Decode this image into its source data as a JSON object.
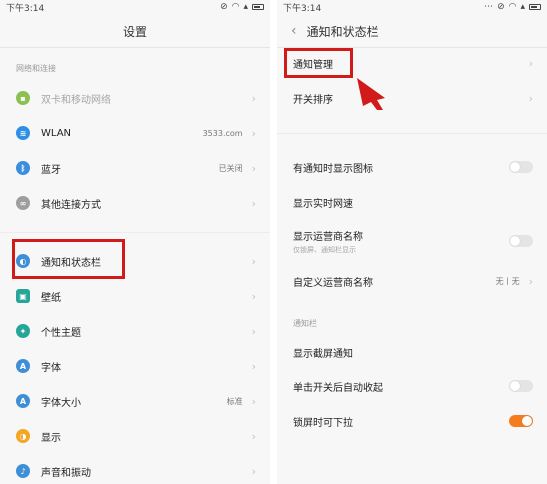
{
  "left_screen": {
    "status": {
      "time": "下午3:14"
    },
    "title": "设置",
    "section_network": "网络和连接",
    "items": [
      {
        "label": "双卡和移动网络",
        "value": "",
        "icon": "sim-card-icon",
        "color": "#8cc152",
        "dim": true
      },
      {
        "label": "WLAN",
        "value": "3533.com",
        "icon": "wifi-icon",
        "color": "#2f8ee5",
        "dim": false
      },
      {
        "label": "蓝牙",
        "value": "已关闭",
        "icon": "bluetooth-icon",
        "color": "#3b8de0",
        "dim": false
      },
      {
        "label": "其他连接方式",
        "value": "",
        "icon": "link-icon",
        "color": "#9e9e9e",
        "dim": false
      },
      {
        "label": "通知和状态栏",
        "value": "",
        "icon": "notification-icon",
        "color": "#3f8fd8",
        "dim": false
      },
      {
        "label": "壁纸",
        "value": "",
        "icon": "wallpaper-icon",
        "color": "#26a69a",
        "dim": false
      },
      {
        "label": "个性主题",
        "value": "",
        "icon": "theme-icon",
        "color": "#26a69a",
        "dim": false
      },
      {
        "label": "字体",
        "value": "",
        "icon": "font-icon",
        "color": "#3f8fd8",
        "dim": false
      },
      {
        "label": "字体大小",
        "value": "标准",
        "icon": "font-size-icon",
        "color": "#3f8fd8",
        "dim": false
      },
      {
        "label": "显示",
        "value": "",
        "icon": "display-icon",
        "color": "#f5a623",
        "dim": false
      },
      {
        "label": "声音和振动",
        "value": "",
        "icon": "sound-icon",
        "color": "#3f8fd8",
        "dim": false
      }
    ]
  },
  "right_screen": {
    "status": {
      "time": "下午3:14"
    },
    "title": "通知和状态栏",
    "items_top": [
      {
        "label": "通知管理"
      },
      {
        "label": "开关排序"
      }
    ],
    "items_toggles": [
      {
        "label": "有通知时显示图标",
        "sub": "",
        "state": "off"
      },
      {
        "label": "显示实时网速",
        "sub": "",
        "state": "none"
      },
      {
        "label": "显示运营商名称",
        "sub": "仅锁屏、通知栏显示",
        "state": "off"
      },
      {
        "label": "自定义运营商名称",
        "value": "无丨无",
        "state": "chevron"
      }
    ],
    "section_bar": "通知栏",
    "items_bar": [
      {
        "label": "显示截屏通知",
        "state": "none"
      },
      {
        "label": "单击开关后自动收起",
        "state": "off"
      },
      {
        "label": "锁屏时可下拉",
        "state": "on"
      }
    ]
  },
  "colors": {
    "accent": "#f57c1f",
    "annotation": "#d11a1a"
  }
}
